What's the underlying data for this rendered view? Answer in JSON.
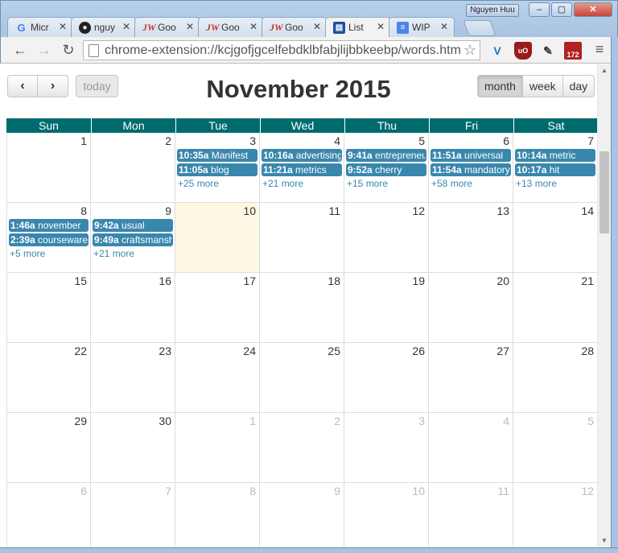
{
  "window": {
    "user": "Nguyen Huu",
    "minimize": "‒",
    "maximize": "▢",
    "close": "✕"
  },
  "tabs": [
    {
      "label": "Micr",
      "icon": "G",
      "icon_name": "google-icon"
    },
    {
      "label": "nguy",
      "icon": "●",
      "icon_name": "github-icon"
    },
    {
      "label": "Goo",
      "icon": "JW",
      "icon_name": "jw-icon"
    },
    {
      "label": "Goo",
      "icon": "JW",
      "icon_name": "jw-icon"
    },
    {
      "label": "Goo",
      "icon": "JW",
      "icon_name": "jw-icon"
    },
    {
      "label": "List",
      "icon": "▤",
      "icon_name": "list-icon"
    },
    {
      "label": "WIP",
      "icon": "≡",
      "icon_name": "doc-icon"
    }
  ],
  "toolbar": {
    "back": "←",
    "forward": "→",
    "reload": "↻",
    "url": "chrome-extension://kcjgofjgcelfebdklbfabjlijbbkeebp/words.htm",
    "star": "☆",
    "ext_save_badge": "172",
    "menu": "≡"
  },
  "calendar": {
    "prev": "‹",
    "next": "›",
    "today": "today",
    "title": "November 2015",
    "views": [
      "month",
      "week",
      "day"
    ],
    "active_view": "month",
    "weekdays": [
      "Sun",
      "Mon",
      "Tue",
      "Wed",
      "Thu",
      "Fri",
      "Sat"
    ],
    "weeks": [
      [
        {
          "num": "1",
          "events": [],
          "more": ""
        },
        {
          "num": "2",
          "events": [],
          "more": ""
        },
        {
          "num": "3",
          "events": [
            {
              "time": "10:35a",
              "title": "Manifest"
            },
            {
              "time": "11:05a",
              "title": "blog"
            }
          ],
          "more": "+25 more"
        },
        {
          "num": "4",
          "events": [
            {
              "time": "10:16a",
              "title": "advertising"
            },
            {
              "time": "11:21a",
              "title": "metrics"
            }
          ],
          "more": "+21 more"
        },
        {
          "num": "5",
          "events": [
            {
              "time": "9:41a",
              "title": "entrepreneur"
            },
            {
              "time": "9:52a",
              "title": "cherry"
            }
          ],
          "more": "+15 more"
        },
        {
          "num": "6",
          "events": [
            {
              "time": "11:51a",
              "title": "universal"
            },
            {
              "time": "11:54a",
              "title": "mandatory"
            }
          ],
          "more": "+58 more"
        },
        {
          "num": "7",
          "events": [
            {
              "time": "10:14a",
              "title": "metric"
            },
            {
              "time": "10:17a",
              "title": "hit"
            }
          ],
          "more": "+13 more"
        }
      ],
      [
        {
          "num": "8",
          "events": [
            {
              "time": "1:46a",
              "title": "november"
            },
            {
              "time": "2:39a",
              "title": "courseware"
            }
          ],
          "more": "+5 more"
        },
        {
          "num": "9",
          "events": [
            {
              "time": "9:42a",
              "title": "usual"
            },
            {
              "time": "9:49a",
              "title": "craftsmanship"
            }
          ],
          "more": "+21 more"
        },
        {
          "num": "10",
          "events": [],
          "more": "",
          "today": true
        },
        {
          "num": "11",
          "events": [],
          "more": ""
        },
        {
          "num": "12",
          "events": [],
          "more": ""
        },
        {
          "num": "13",
          "events": [],
          "more": ""
        },
        {
          "num": "14",
          "events": [],
          "more": ""
        }
      ],
      [
        {
          "num": "15",
          "events": [],
          "more": ""
        },
        {
          "num": "16",
          "events": [],
          "more": ""
        },
        {
          "num": "17",
          "events": [],
          "more": ""
        },
        {
          "num": "18",
          "events": [],
          "more": ""
        },
        {
          "num": "19",
          "events": [],
          "more": ""
        },
        {
          "num": "20",
          "events": [],
          "more": ""
        },
        {
          "num": "21",
          "events": [],
          "more": ""
        }
      ],
      [
        {
          "num": "22",
          "events": [],
          "more": ""
        },
        {
          "num": "23",
          "events": [],
          "more": ""
        },
        {
          "num": "24",
          "events": [],
          "more": ""
        },
        {
          "num": "25",
          "events": [],
          "more": ""
        },
        {
          "num": "26",
          "events": [],
          "more": ""
        },
        {
          "num": "27",
          "events": [],
          "more": ""
        },
        {
          "num": "28",
          "events": [],
          "more": ""
        }
      ],
      [
        {
          "num": "29",
          "events": [],
          "more": ""
        },
        {
          "num": "30",
          "events": [],
          "more": ""
        },
        {
          "num": "1",
          "events": [],
          "more": "",
          "other": true
        },
        {
          "num": "2",
          "events": [],
          "more": "",
          "other": true
        },
        {
          "num": "3",
          "events": [],
          "more": "",
          "other": true
        },
        {
          "num": "4",
          "events": [],
          "more": "",
          "other": true
        },
        {
          "num": "5",
          "events": [],
          "more": "",
          "other": true
        }
      ],
      [
        {
          "num": "6",
          "events": [],
          "more": "",
          "other": true
        },
        {
          "num": "7",
          "events": [],
          "more": "",
          "other": true
        },
        {
          "num": "8",
          "events": [],
          "more": "",
          "other": true
        },
        {
          "num": "9",
          "events": [],
          "more": "",
          "other": true
        },
        {
          "num": "10",
          "events": [],
          "more": "",
          "other": true
        },
        {
          "num": "11",
          "events": [],
          "more": "",
          "other": true
        },
        {
          "num": "12",
          "events": [],
          "more": "",
          "other": true
        }
      ]
    ],
    "scrollbar": {
      "up": "▲",
      "down": "▼"
    }
  }
}
